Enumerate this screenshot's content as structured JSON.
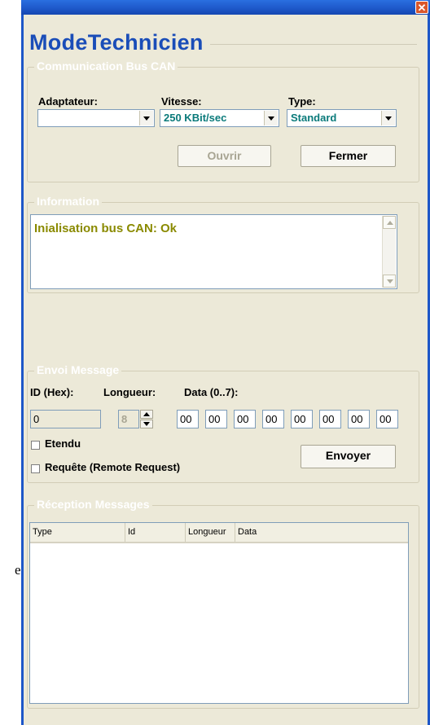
{
  "window": {
    "title": "ModeTechnicien",
    "close_glyph": "✕",
    "stray_char": "e"
  },
  "communication": {
    "title": "Communication Bus CAN",
    "adaptateur_label": "Adaptateur:",
    "adaptateur_value": "",
    "vitesse_label": "Vitesse:",
    "vitesse_value": "250 KBit/sec",
    "type_label": "Type:",
    "type_value": "Standard",
    "ouvrir_label": "Ouvrir",
    "fermer_label": "Fermer"
  },
  "information": {
    "title": "Information",
    "text": "Inialisation bus CAN: Ok"
  },
  "envoi": {
    "title": "Envoi Message",
    "id_label": "ID (Hex):",
    "id_value": "0",
    "longueur_label": "Longueur:",
    "longueur_value": "8",
    "data_label": "Data (0..7):",
    "data": [
      "00",
      "00",
      "00",
      "00",
      "00",
      "00",
      "00",
      "00"
    ],
    "etendu_label": "Etendu",
    "requete_label": "Requête (Remote Request)",
    "envoyer_label": "Envoyer"
  },
  "reception": {
    "title": "Réception Messages",
    "columns": [
      "Type",
      "Id",
      "Longueur",
      "Data"
    ]
  },
  "colors": {
    "title_blue": "#1a4db8",
    "info_text": "#8a8a00",
    "combo_text": "#0a7a7a",
    "window_bg": "#ece9d8"
  }
}
